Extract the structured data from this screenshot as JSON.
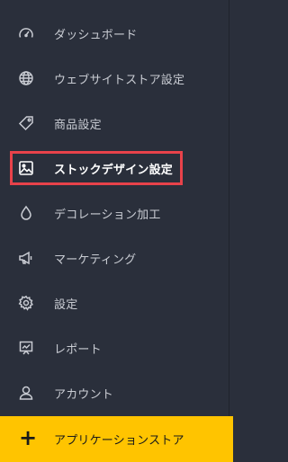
{
  "sidebar": {
    "items": [
      {
        "label": "ダッシュボード",
        "icon": "speedometer-icon"
      },
      {
        "label": "ウェブサイトストア設定",
        "icon": "globe-icon"
      },
      {
        "label": "商品設定",
        "icon": "tag-icon"
      },
      {
        "label": "ストックデザイン設定",
        "icon": "image-icon",
        "active": true
      },
      {
        "label": "デコレーション加工",
        "icon": "droplet-icon"
      },
      {
        "label": "マーケティング",
        "icon": "megaphone-icon"
      },
      {
        "label": "設定",
        "icon": "gear-icon"
      },
      {
        "label": "レポート",
        "icon": "report-icon"
      },
      {
        "label": "アカウント",
        "icon": "user-icon"
      }
    ],
    "cta": {
      "label": "アプリケーションストア",
      "icon": "plus-icon",
      "symbol": "+"
    }
  },
  "colors": {
    "background": "#2a2f3b",
    "text": "#c9ccd3",
    "active_text": "#ffffff",
    "highlight_border": "#e8424a",
    "cta_background": "#ffc400"
  }
}
